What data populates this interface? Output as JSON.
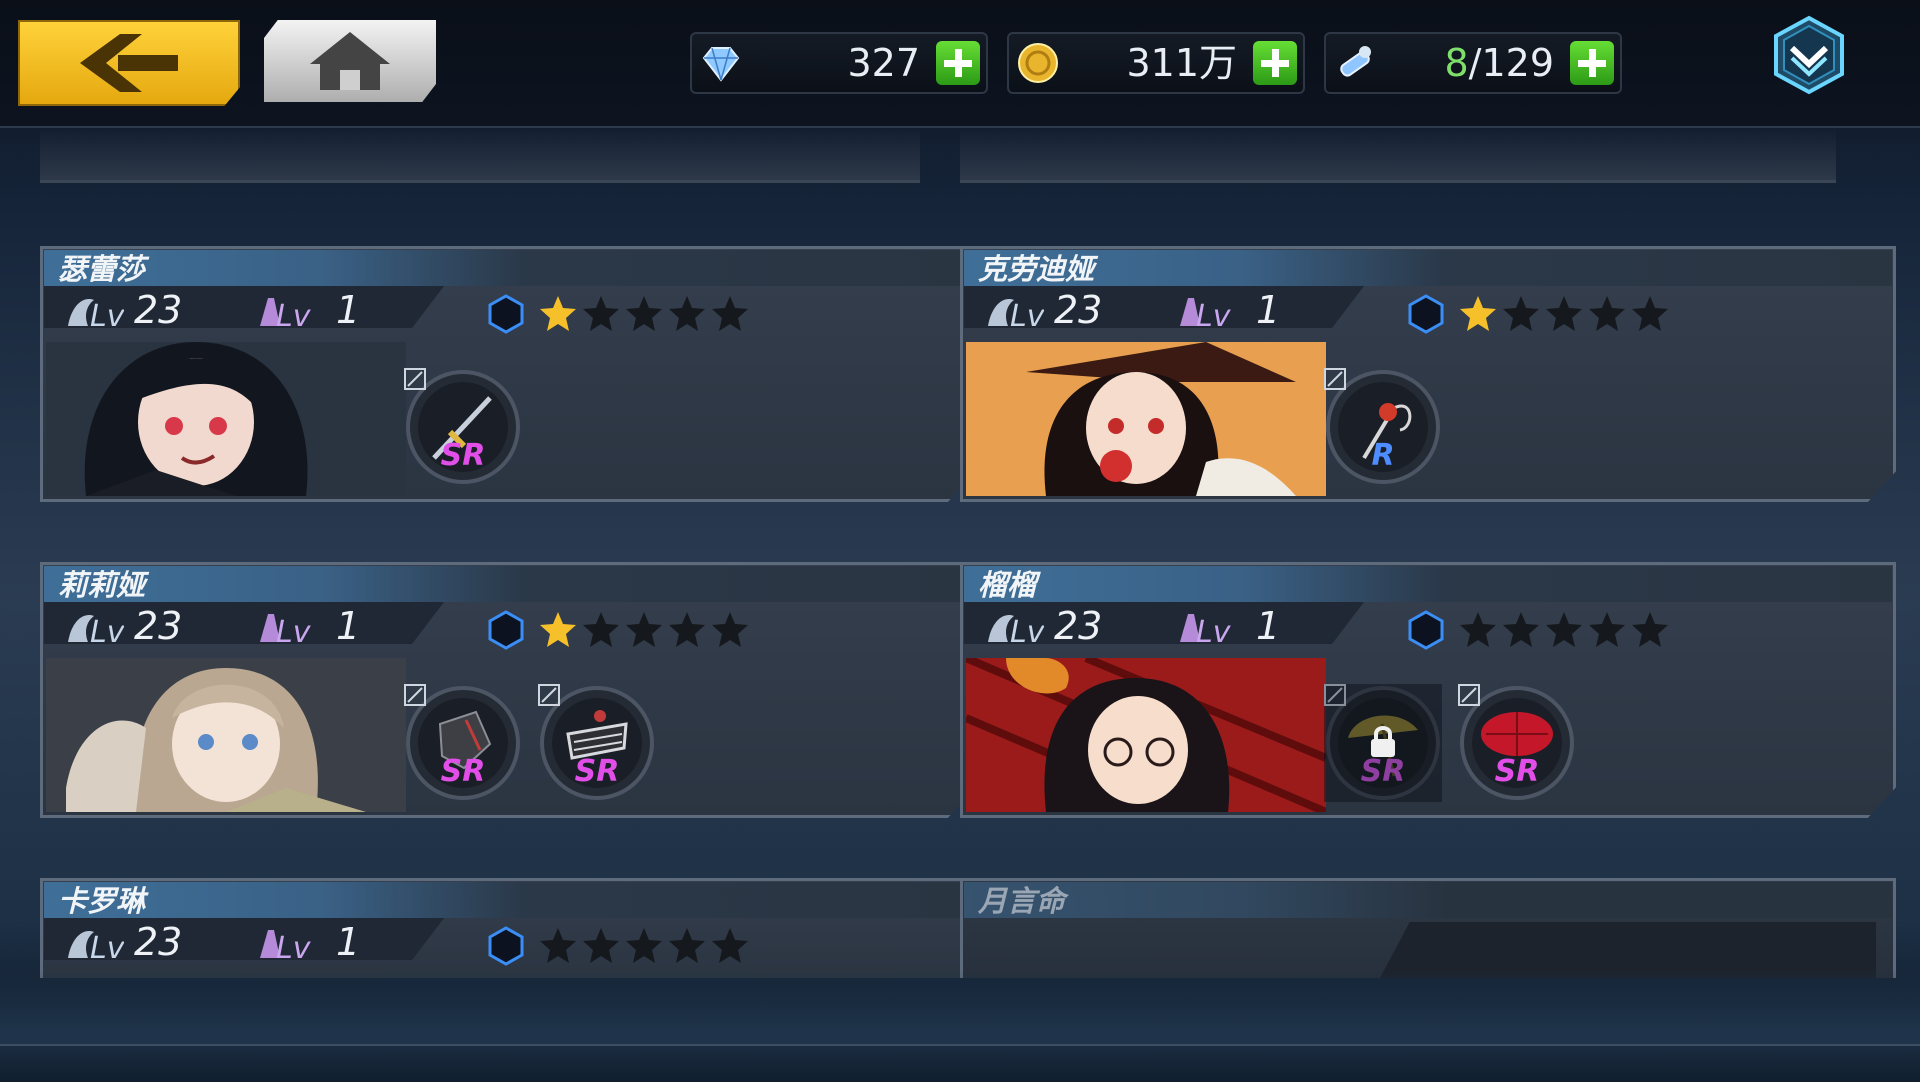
{
  "top_bar": {
    "back_icon": "chevron-left-icon",
    "home_icon": "home-icon",
    "gems": "327",
    "gold": "311万",
    "stamina": {
      "current": "8",
      "separator": "/",
      "max": "129"
    },
    "dropdown_icon": "chevron-down-icon"
  },
  "colors": {
    "star_filled": "#f5c02a",
    "star_empty": "#15181d",
    "rarity_sr": "#e24ee8",
    "rarity_r": "#4d8dff",
    "hex_blue": "#3a8ef5"
  },
  "characters": [
    {
      "name": "瑟蕾莎",
      "level": "23",
      "class_level": "1",
      "stars_filled": 1,
      "stars_total": 5,
      "equipment": [
        {
          "rarity": "SR",
          "icon": "sword-icon",
          "locked": false
        }
      ]
    },
    {
      "name": "克劳迪娅",
      "level": "23",
      "class_level": "1",
      "stars_filled": 1,
      "stars_total": 5,
      "equipment": [
        {
          "rarity": "R",
          "icon": "rose-staff-icon",
          "locked": false
        }
      ]
    },
    {
      "name": "莉莉娅",
      "level": "23",
      "class_level": "1",
      "stars_filled": 1,
      "stars_total": 5,
      "equipment": [
        {
          "rarity": "SR",
          "icon": "gauntlet-icon",
          "locked": false
        },
        {
          "rarity": "SR",
          "icon": "claw-icon",
          "locked": false
        }
      ]
    },
    {
      "name": "榴榴",
      "level": "23",
      "class_level": "1",
      "stars_filled": 0,
      "stars_total": 5,
      "equipment": [
        {
          "rarity": "SR",
          "icon": "umbrella-icon",
          "locked": true
        },
        {
          "rarity": "SR",
          "icon": "red-umbrella-icon",
          "locked": false
        }
      ]
    },
    {
      "name": "卡罗琳",
      "level": "23",
      "class_level": "1",
      "stars_filled": 0,
      "stars_total": 5,
      "equipment": []
    },
    {
      "name": "月言命",
      "locked": true
    }
  ]
}
